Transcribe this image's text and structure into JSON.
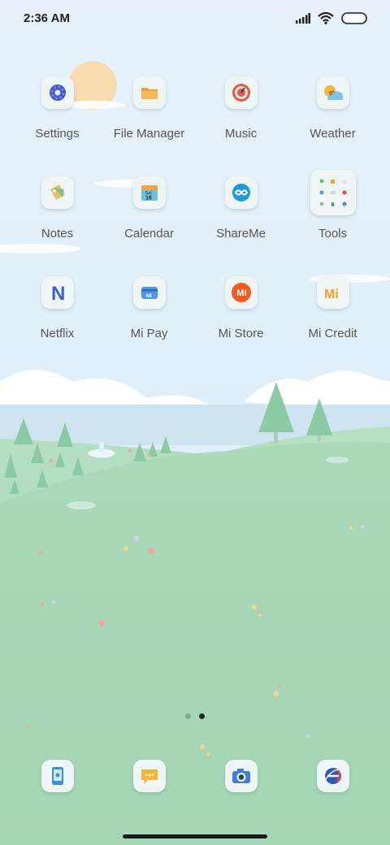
{
  "status_bar": {
    "time": "2:36 AM",
    "icons": [
      "signal-icon",
      "wifi-icon",
      "battery-icon"
    ]
  },
  "apps": [
    {
      "label": "Settings",
      "icon": "settings-icon"
    },
    {
      "label": "File Manager",
      "icon": "folder-icon"
    },
    {
      "label": "Music",
      "icon": "music-icon"
    },
    {
      "label": "Weather",
      "icon": "weather-icon",
      "icon_text": "0°"
    },
    {
      "label": "Notes",
      "icon": "notes-icon"
    },
    {
      "label": "Calendar",
      "icon": "calendar-icon",
      "icon_text": "Sat",
      "icon_day": "16"
    },
    {
      "label": "ShareMe",
      "icon": "shareme-icon"
    },
    {
      "label": "Tools",
      "icon": "tools-folder-icon"
    },
    {
      "label": "Netflix",
      "icon": "netflix-icon",
      "icon_text": "N"
    },
    {
      "label": "Mi Pay",
      "icon": "mi-pay-icon",
      "icon_text": "MI"
    },
    {
      "label": "Mi Store",
      "icon": "mi-store-icon",
      "icon_text": "MI"
    },
    {
      "label": "Mi Credit",
      "icon": "mi-credit-icon",
      "icon_text": "Mi"
    }
  ],
  "dock": [
    {
      "name": "phone",
      "icon": "phone-icon"
    },
    {
      "name": "messages",
      "icon": "messages-icon"
    },
    {
      "name": "camera",
      "icon": "camera-icon"
    },
    {
      "name": "browser",
      "icon": "browser-icon"
    }
  ],
  "page_indicator": {
    "pages": 2,
    "current": 2
  },
  "colors": {
    "sky": "#dceef9",
    "grass": "#9fd2b3",
    "accent": "#ff6700"
  }
}
